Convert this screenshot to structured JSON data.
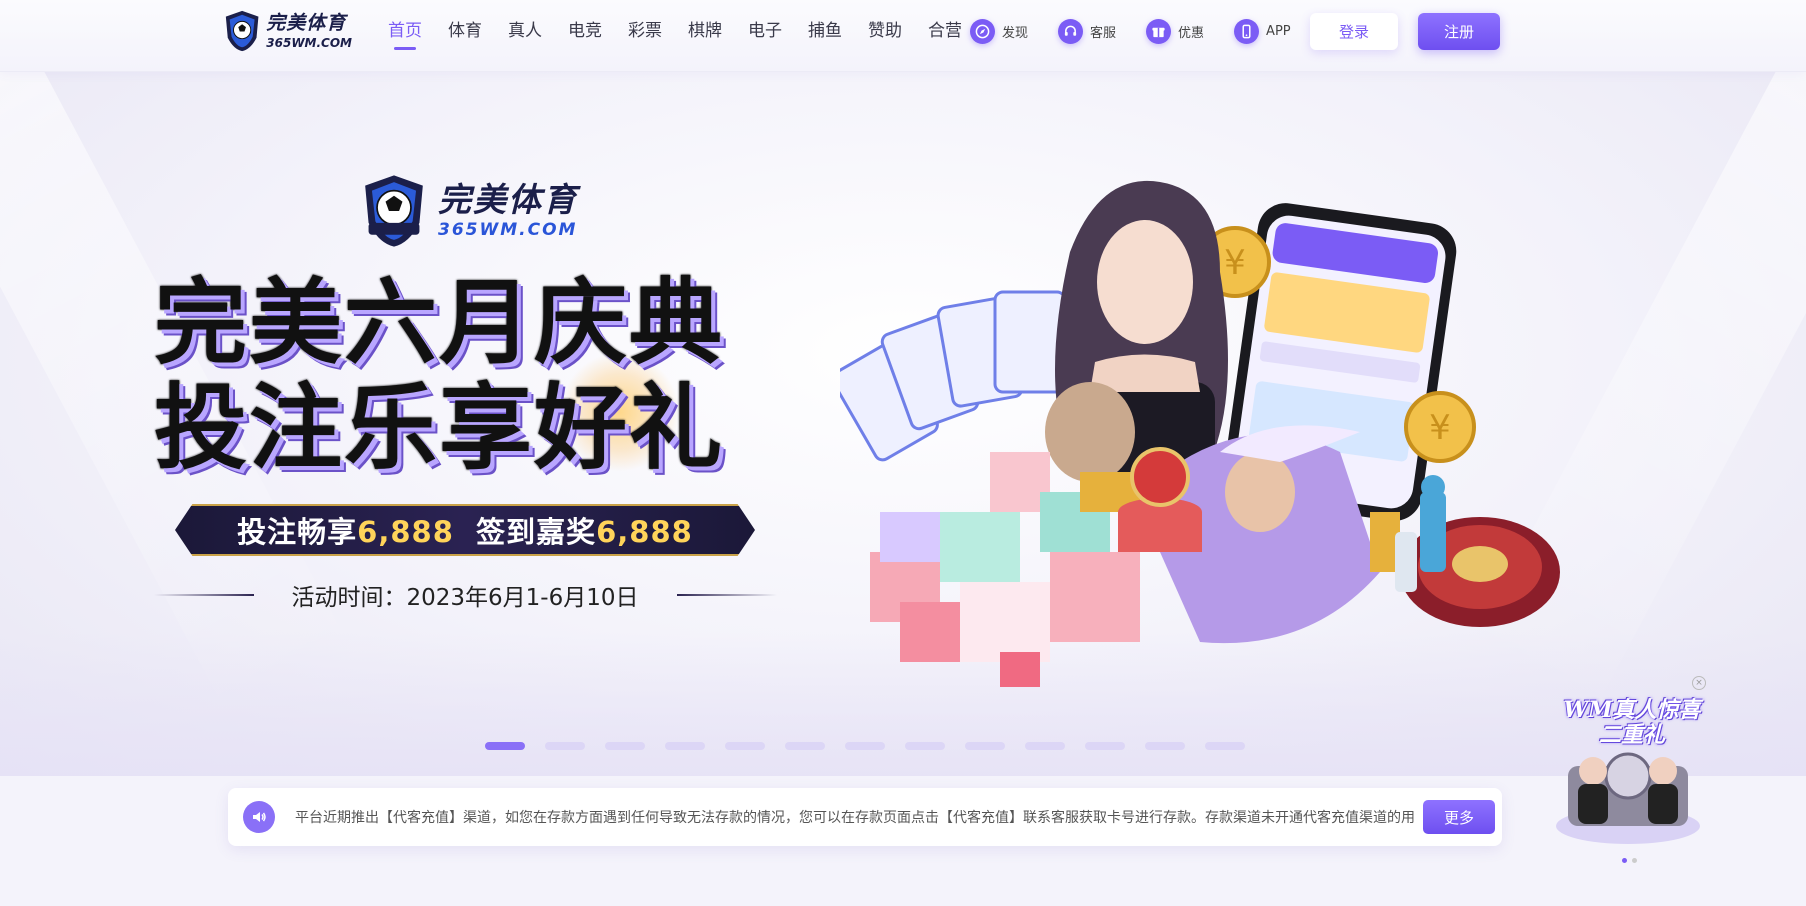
{
  "header": {
    "logo": {
      "cn": "完美体育",
      "en": "365WM.COM"
    },
    "nav": [
      {
        "label": "首页",
        "active": true
      },
      {
        "label": "体育"
      },
      {
        "label": "真人"
      },
      {
        "label": "电竞"
      },
      {
        "label": "彩票"
      },
      {
        "label": "棋牌"
      },
      {
        "label": "电子"
      },
      {
        "label": "捕鱼"
      },
      {
        "label": "赞助"
      },
      {
        "label": "合营"
      }
    ],
    "tools": [
      {
        "label": "发现",
        "icon": "compass-icon"
      },
      {
        "label": "客服",
        "icon": "headset-icon"
      },
      {
        "label": "优惠",
        "icon": "gift-icon"
      },
      {
        "label": "APP",
        "icon": "phone-icon"
      }
    ],
    "login_label": "登录",
    "register_label": "注册"
  },
  "banner": {
    "logo": {
      "cn": "完美体育",
      "en": "365WM.COM"
    },
    "headline_line1": "完美六月庆典",
    "headline_line2": "投注乐享好礼",
    "ribbon": {
      "text1": "投注畅享",
      "num1": "6,888",
      "text2": "签到嘉奖",
      "num2": "6,888"
    },
    "period": "活动时间：2023年6月1-6月10日",
    "slide_count": 13,
    "active_slide": 1
  },
  "notice": {
    "text": "平台近期推出【代客充值】渠道，如您在存款方面遇到任何导致无法存款的情况，您可以在存款页面点击【代客充值】联系客服获取卡号进行存款。存款渠道未开通代客充值渠道的用户，",
    "more_label": "更多"
  },
  "float_ad": {
    "title": "WM真人惊喜二重礼",
    "close_symbol": "×",
    "slide_count": 2,
    "active_slide": 1
  },
  "colors": {
    "accent": "#7b5cf5",
    "gold": "#ffd45a",
    "navy": "#1b1f4a"
  }
}
